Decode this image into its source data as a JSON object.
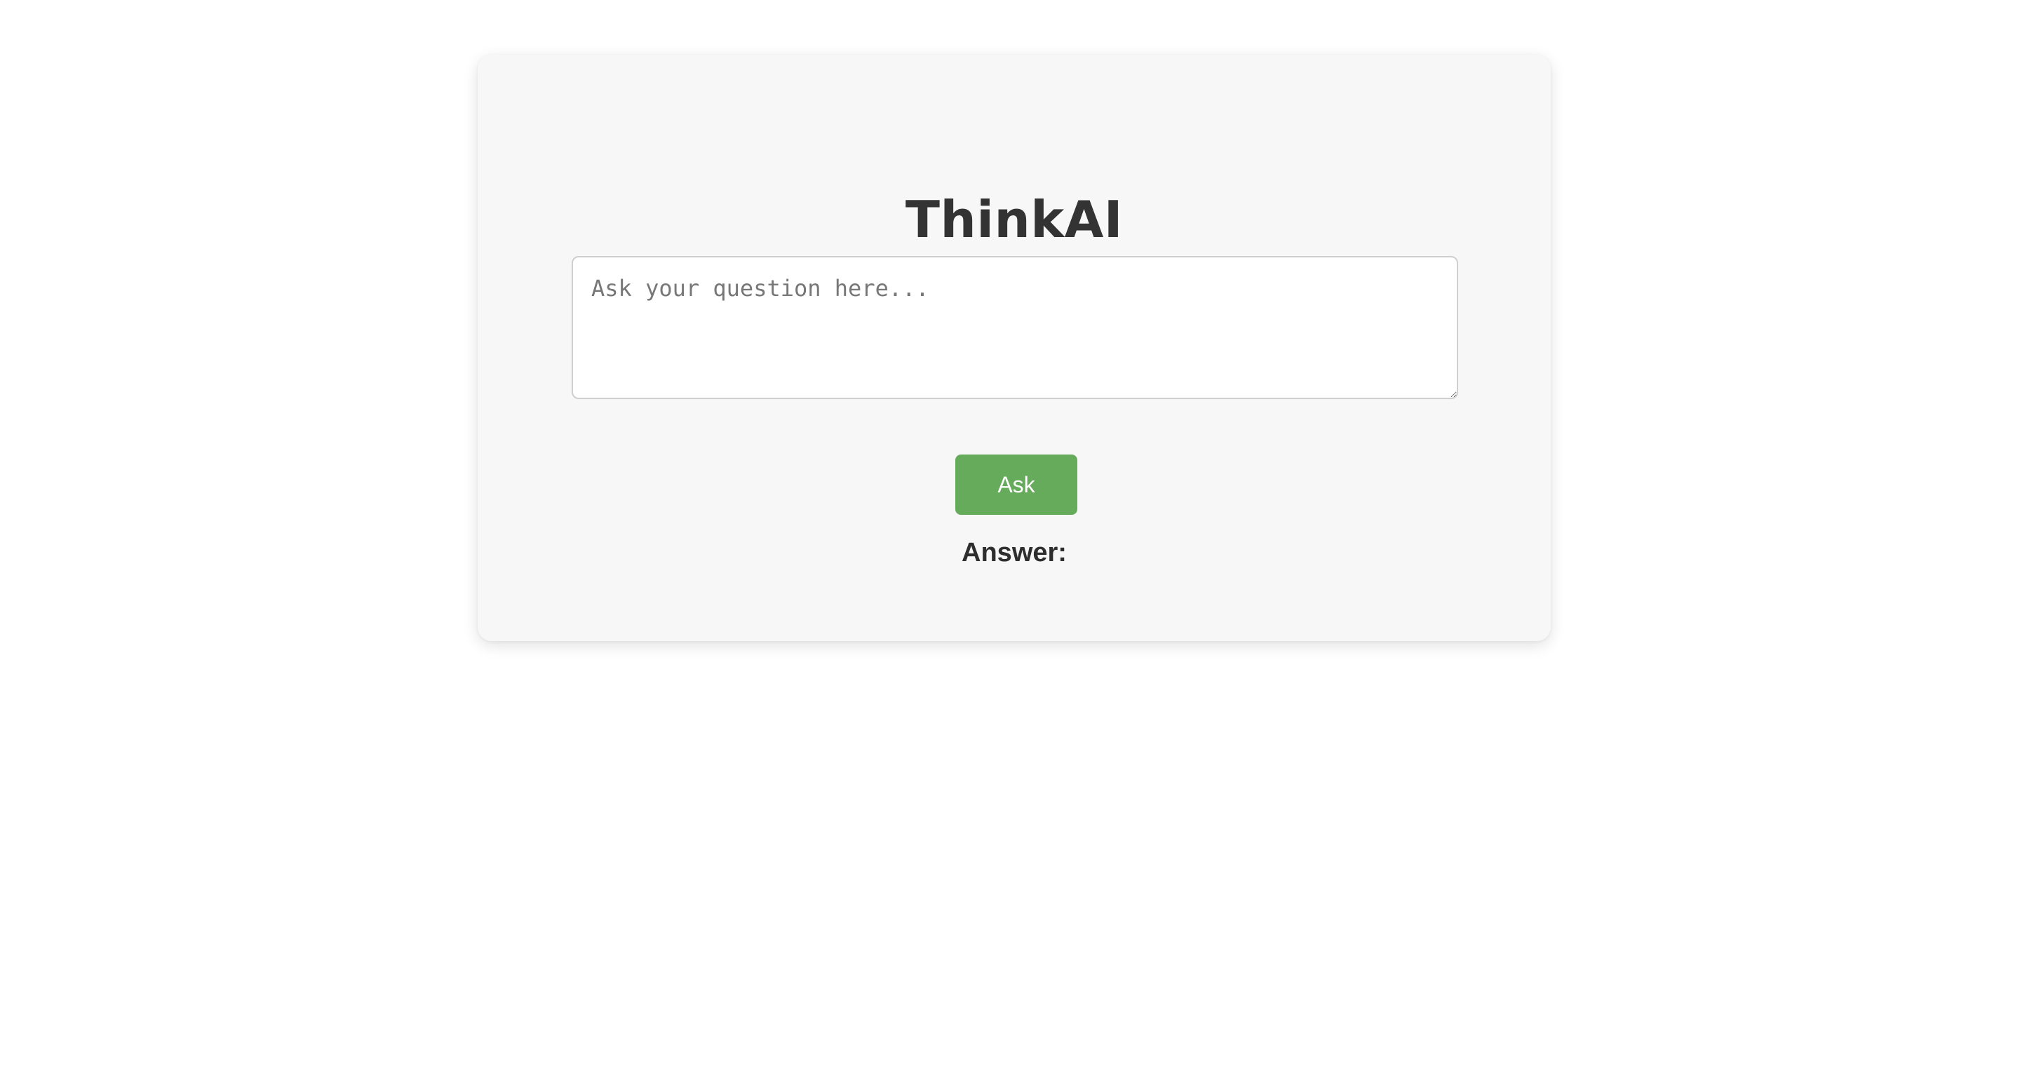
{
  "app": {
    "title": "ThinkAI"
  },
  "question": {
    "value": "",
    "placeholder": "Ask your question here..."
  },
  "actions": {
    "ask_label": "Ask"
  },
  "answer": {
    "label": "Answer:",
    "text": ""
  },
  "colors": {
    "page_background": "#ffffff",
    "card_background": "#f7f7f7",
    "title_text": "#333333",
    "button_background": "#66ab5b",
    "button_text": "#ffffff",
    "input_border": "#cfcfcf"
  }
}
